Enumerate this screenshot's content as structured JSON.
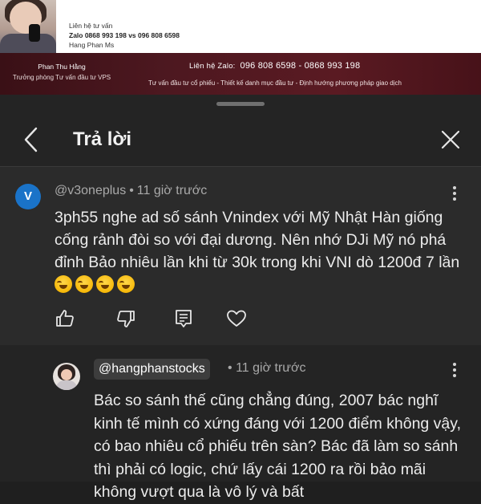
{
  "banner": {
    "contact_heading": "Liên hệ tư vấn",
    "contact_phones": "Zalo 0868 993 198 vs 096 808 6598",
    "contact_name": "Hang Phan Ms",
    "presenter_name": "Phan Thu Hằng",
    "presenter_title": "Trưởng phòng Tư vấn đầu tư VPS",
    "zalo_label": "Liên hệ Zalo:",
    "zalo_numbers": "096 808 6598 - 0868 993 198",
    "tagline": "Tư vấn đầu tư cổ phiếu - Thiết kế danh mục đầu tư - Định hướng phương pháp giao dịch"
  },
  "sheet": {
    "title": "Trả lời",
    "back_icon": "chevron-left-icon",
    "close_icon": "close-icon"
  },
  "comment": {
    "avatar_letter": "V",
    "avatar_color": "#1a73c8",
    "author": "@v3oneplus",
    "time": "11 giờ trước",
    "text": "3ph55 nghe ad số sánh Vnindex với Mỹ Nhật Hàn giống cống rảnh đòi so với đại dương. Nên nhớ DJi Mỹ nó phá đỉnh Bảo nhiêu lần khi từ 30k trong khi VNI dò 1200đ 7 lần",
    "emoji_count": 4,
    "actions": [
      "like-icon",
      "dislike-icon",
      "reply-icon",
      "heart-icon"
    ]
  },
  "reply": {
    "author": "@hangphanstocks",
    "time": "11 giờ trước",
    "text": "Bác so sánh thế cũng chẳng đúng, 2007 bác nghĩ kinh tế mình có xứng đáng với 1200 điểm không vậy, có bao nhiêu cổ phiếu trên sàn? Bác đã làm so sánh thì phải có logic, chứ lấy cái 1200 ra rồi bảo mãi không vượt qua là vô lý và bất"
  }
}
